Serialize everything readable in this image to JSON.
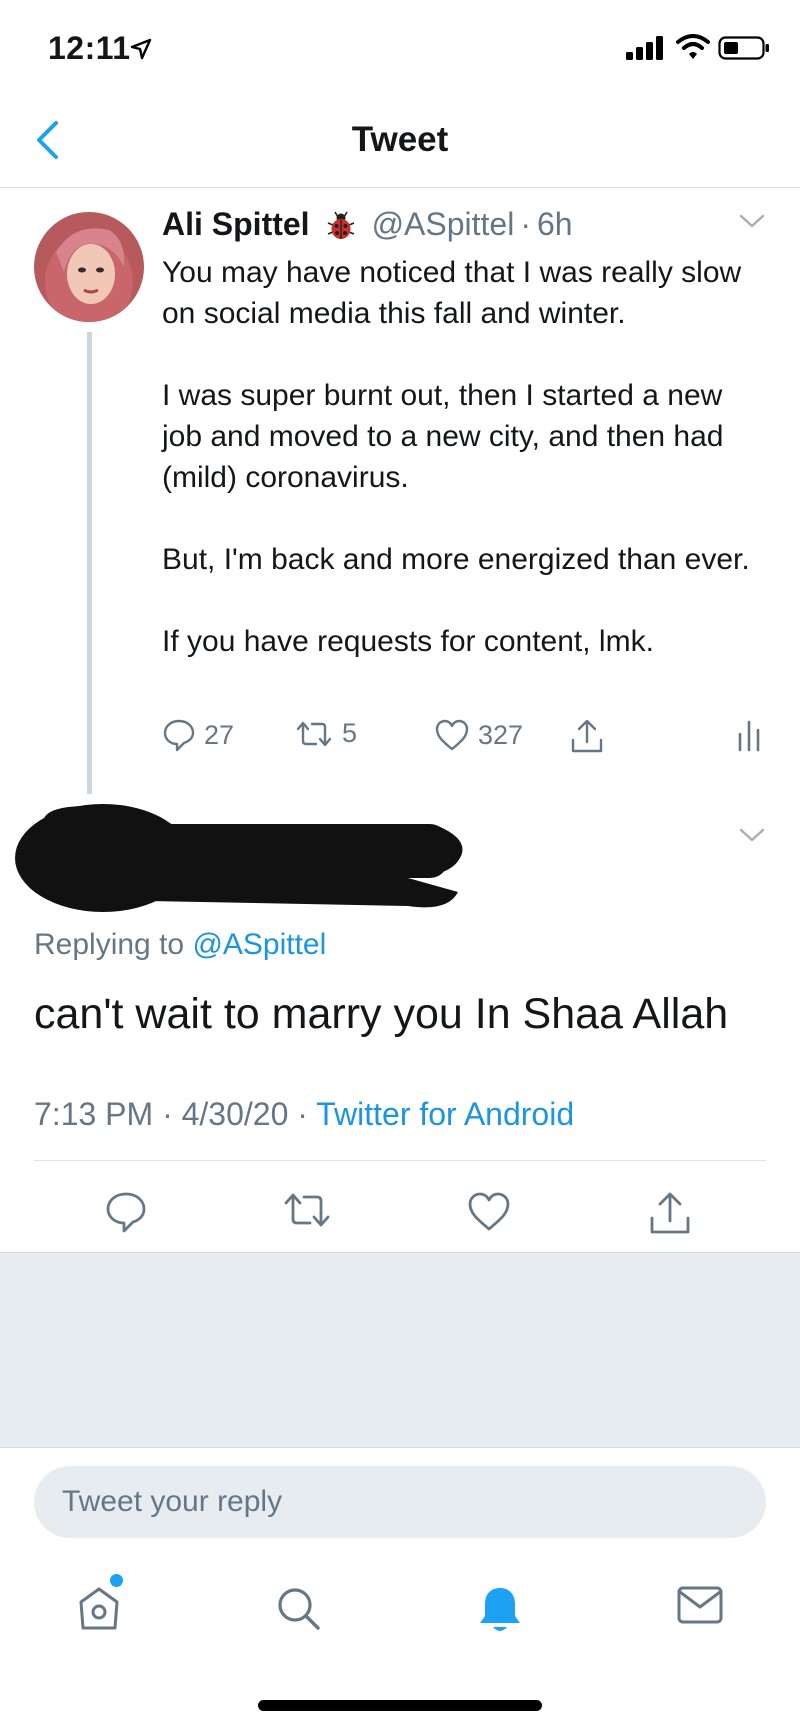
{
  "status_bar": {
    "time": "12:11"
  },
  "header": {
    "title": "Tweet"
  },
  "parent_tweet": {
    "author_name": "Ali Spittel",
    "handle": "@ASpittel",
    "separator": "·",
    "time_ago": "6h",
    "paragraphs": [
      "You may have noticed that I was really slow on social media this fall and winter.",
      "I was super burnt out, then I started a new job and moved to a new city, and then had (mild) coronavirus.",
      "But, I'm back and more energized than ever.",
      "If you have requests for content, lmk."
    ],
    "replies_count": "27",
    "retweets_count": "5",
    "likes_count": "327"
  },
  "reply_tweet": {
    "replying_prefix": "Replying to",
    "replying_to": "@ASpittel",
    "text": "can't wait to marry you In Shaa Allah",
    "time": "7:13 PM",
    "separator": "·",
    "date": "4/30/20",
    "source": "Twitter for Android"
  },
  "composer": {
    "placeholder": "Tweet your reply"
  },
  "colors": {
    "accent": "#1da1f2",
    "link": "#1b95e0",
    "secondary_text": "#657786",
    "background_grey": "#e6ecf0"
  },
  "icons": {
    "back": "chevron-left-icon",
    "reply": "speech-bubble-icon",
    "retweet": "retweet-icon",
    "like": "heart-icon",
    "share": "share-icon",
    "analytics": "bar-chart-icon",
    "home": "home-icon",
    "search": "search-icon",
    "notifications": "bell-icon",
    "messages": "envelope-icon"
  }
}
